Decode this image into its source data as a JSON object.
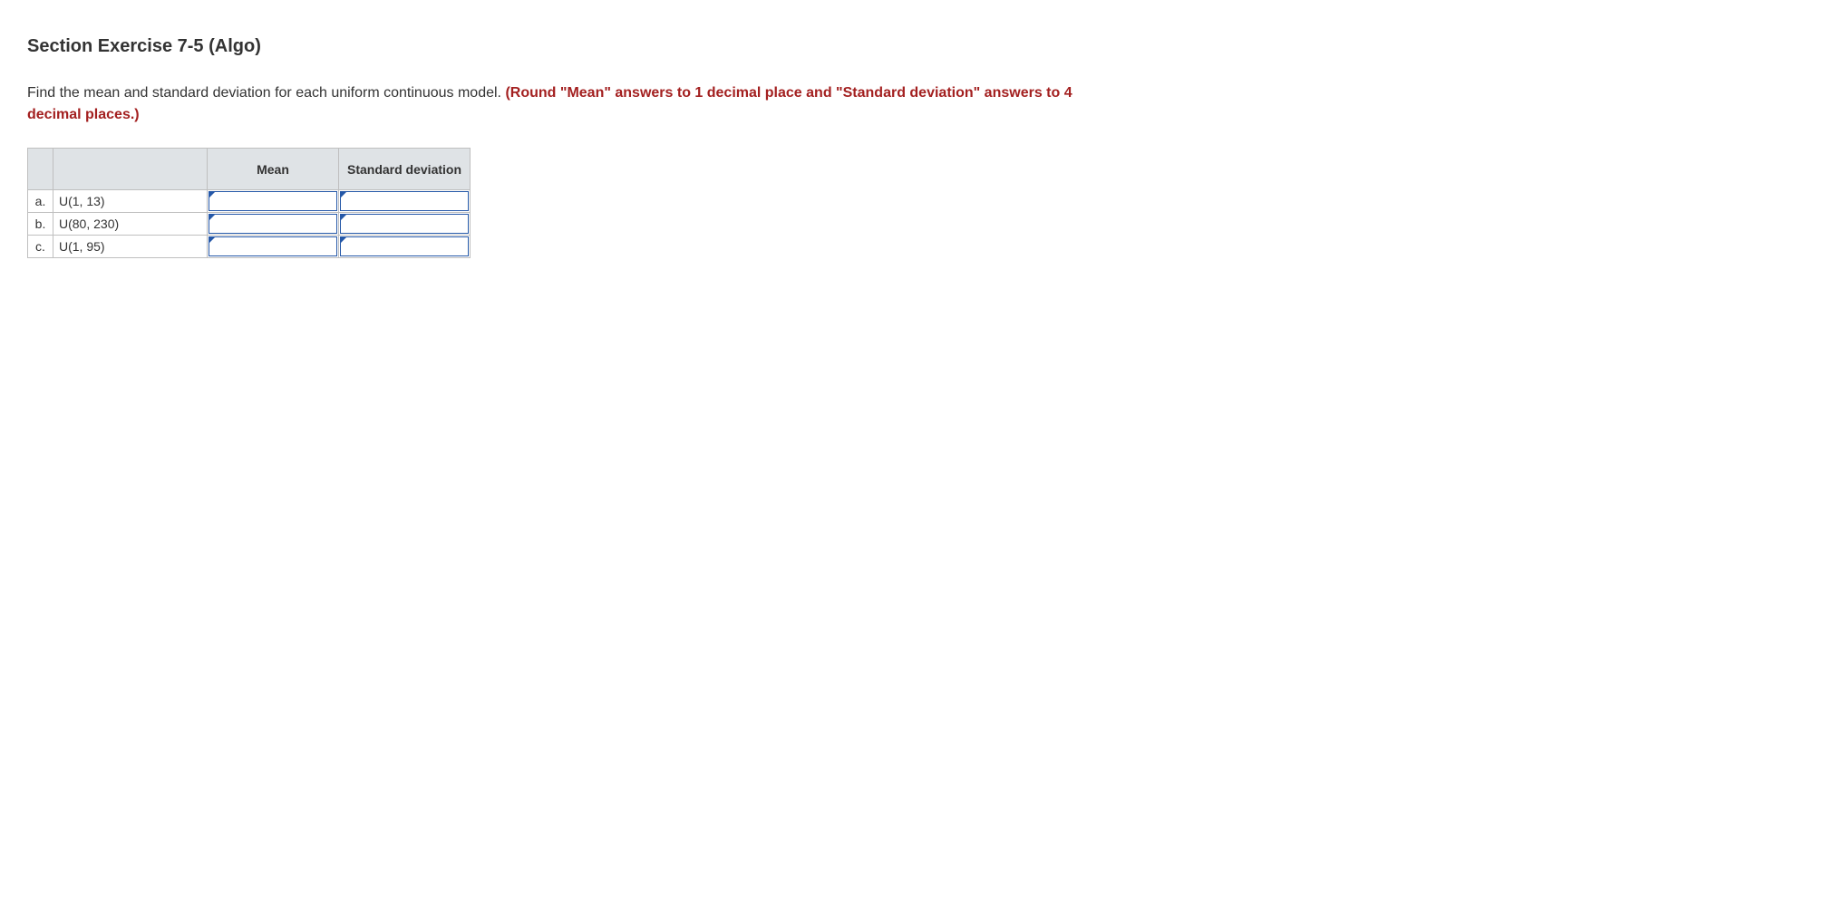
{
  "title": "Section Exercise 7-5 (Algo)",
  "instructions": {
    "plain": "Find the mean and standard deviation for each uniform continuous model. ",
    "emphasis": "(Round \"Mean\" answers to 1 decimal place and \"Standard deviation\" answers to 4 decimal places.)"
  },
  "table": {
    "headers": {
      "mean": "Mean",
      "stddev": "Standard deviation"
    },
    "rows": [
      {
        "id": "a.",
        "dist": "U(1, 13)",
        "mean": "",
        "stddev": ""
      },
      {
        "id": "b.",
        "dist": "U(80, 230)",
        "mean": "",
        "stddev": ""
      },
      {
        "id": "c.",
        "dist": "U(1, 95)",
        "mean": "",
        "stddev": ""
      }
    ]
  }
}
